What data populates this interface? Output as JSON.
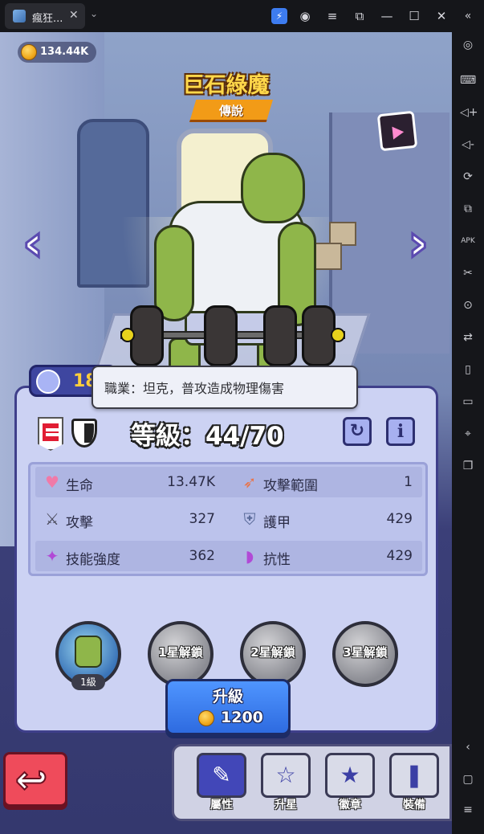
{
  "emulator": {
    "tab_title": "瘋狂...",
    "tab_close": "✕",
    "tab_dropdown": "⌄",
    "toolbar_icons": [
      "bolt-icon",
      "account-icon",
      "menu-icon",
      "screenshot-icon",
      "minimize-icon",
      "maximize-icon",
      "close-icon"
    ],
    "sidebar_icons": [
      "collapse-icon",
      "settings-icon",
      "keyboard-icon",
      "volume-up-icon",
      "volume-down-icon",
      "rotate-icon",
      "multi-instance-icon",
      "apk-icon",
      "cut-icon",
      "record-icon",
      "sync-icon",
      "shake-icon",
      "folder-icon",
      "location-icon",
      "copy-icon",
      "back-icon",
      "home-icon",
      "recents-icon"
    ]
  },
  "currency": {
    "amount": "134.44K",
    "icon": "gold-coin-icon"
  },
  "hero": {
    "name": "巨石綠魔",
    "rarity": "傳說",
    "power_prefix": "18"
  },
  "tooltip": {
    "text": "職業：坦克，普攻造成物理傷害"
  },
  "level": {
    "label": "等級：44/70",
    "current": 44,
    "max": 70,
    "refresh_icon": "↻",
    "info_icon": "i"
  },
  "stats": [
    {
      "icon": "heart-icon",
      "glyph": "♥",
      "color": "#f07aa8",
      "label": "生命",
      "value": "13.47K"
    },
    {
      "icon": "range-arrow-icon",
      "glyph": "➶",
      "color": "#e8744a",
      "label": "攻擊範圍",
      "value": "1"
    },
    {
      "icon": "sword-icon",
      "glyph": "⚔",
      "color": "#4a4a5a",
      "label": "攻擊",
      "value": "327"
    },
    {
      "icon": "shield-icon",
      "glyph": "⛨",
      "color": "#5a6b9a",
      "label": "護甲",
      "value": "429"
    },
    {
      "icon": "wand-icon",
      "glyph": "✦",
      "color": "#b14ad6",
      "label": "技能強度",
      "value": "362"
    },
    {
      "icon": "resist-wave-icon",
      "glyph": "◗",
      "color": "#b14ad6",
      "label": "抗性",
      "value": "429"
    }
  ],
  "skills": [
    {
      "label": "",
      "level": "1級",
      "active": true
    },
    {
      "label": "1星解鎖",
      "level": "",
      "active": false
    },
    {
      "label": "2星解鎖",
      "level": "",
      "active": false
    },
    {
      "label": "3星解鎖",
      "level": "",
      "active": false
    }
  ],
  "upgrade": {
    "label": "升級",
    "cost": "1200"
  },
  "tabs": [
    {
      "label": "屬性",
      "icon": "attributes-icon",
      "glyph": "✎",
      "active": true
    },
    {
      "label": "升星",
      "icon": "star-up-icon",
      "glyph": "☆",
      "active": false
    },
    {
      "label": "徽章",
      "icon": "badge-icon",
      "glyph": "★",
      "active": false
    },
    {
      "label": "裝備",
      "icon": "equipment-icon",
      "glyph": "❚",
      "active": false
    }
  ]
}
